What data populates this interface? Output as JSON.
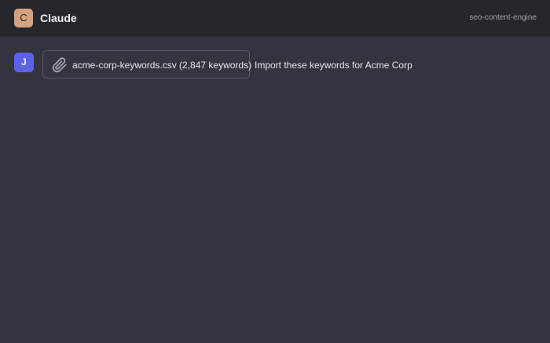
{
  "header": {
    "avatar_letter": "C",
    "title": "Claude",
    "workspace": "seo-content-engine"
  },
  "message": {
    "user_avatar_letter": "J",
    "attachment": {
      "icon": "paperclip-icon",
      "label": "acme-corp-keywords.csv (2,847 keywords)"
    },
    "text": "Import these keywords for Acme Corp"
  },
  "colors": {
    "background": "#34343f",
    "header_background": "#26262c",
    "app_avatar": "#d4a27f",
    "user_avatar": "#5b62e8"
  }
}
